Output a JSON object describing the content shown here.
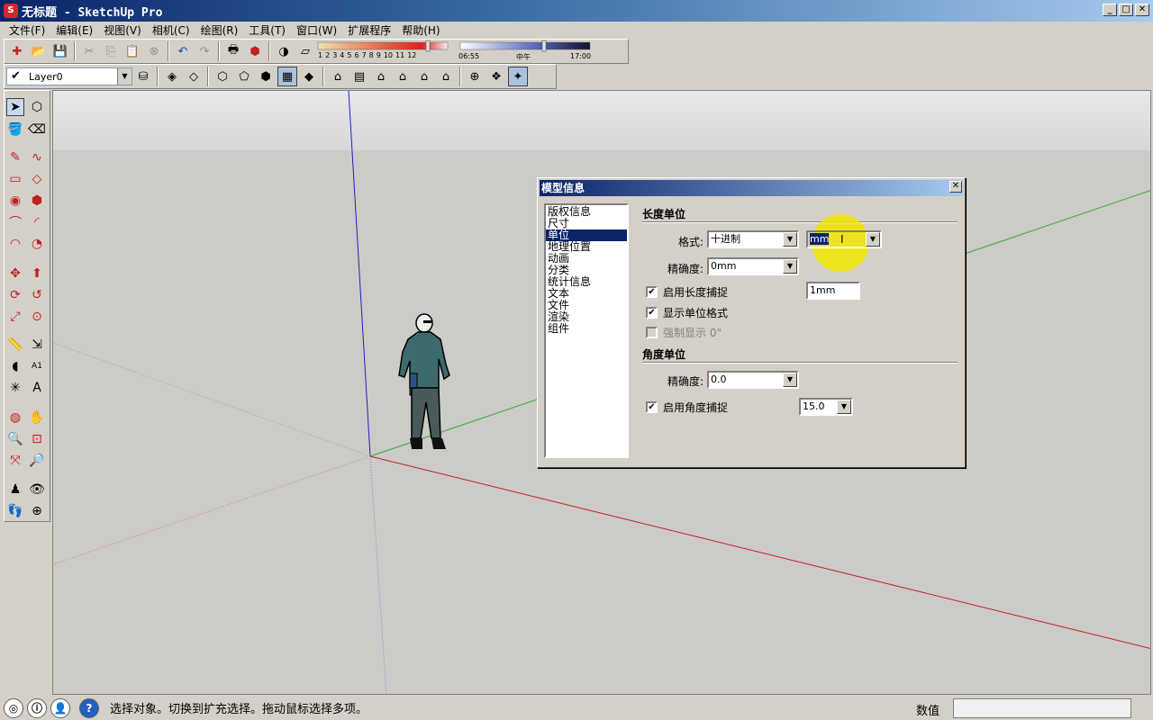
{
  "window": {
    "title": "无标题 - SketchUp Pro",
    "btn_minimize": "_",
    "btn_maximize": "□",
    "btn_close": "✕"
  },
  "menu": {
    "items": [
      "文件(F)",
      "编辑(E)",
      "视图(V)",
      "相机(C)",
      "绘图(R)",
      "工具(T)",
      "窗口(W)",
      "扩展程序",
      "帮助(H)"
    ]
  },
  "toolbar": {
    "shadow_months": [
      "1",
      "2",
      "3",
      "4",
      "5",
      "6",
      "7",
      "8",
      "9",
      "10",
      "11",
      "12"
    ],
    "time_start": "06:55",
    "time_mid": "中午",
    "time_end": "17:00",
    "layer_name": "Layer0"
  },
  "dialog": {
    "title": "模型信息",
    "close": "✕",
    "list_items": [
      "版权信息",
      "尺寸",
      "单位",
      "地理位置",
      "动画",
      "分类",
      "统计信息",
      "文本",
      "文件",
      "渲染",
      "组件"
    ],
    "selected_item": "单位",
    "length_section": "长度单位",
    "format_label": "格式:",
    "format_value": "十进制",
    "unit_value": "mm",
    "precision_label": "精确度:",
    "precision_value": "0mm",
    "enable_length_snap": "启用长度捕捉",
    "length_snap_value": "1mm",
    "show_unit_format": "显示单位格式",
    "force_display": "强制显示 0\"",
    "angle_section": "角度单位",
    "angle_precision_label": "精确度:",
    "angle_precision_value": "0.0",
    "enable_angle_snap": "启用角度捕捉",
    "angle_snap_value": "15.0"
  },
  "status": {
    "message": "选择对象。切换到扩充选择。拖动鼠标选择多项。",
    "measure_label": "数值",
    "measure_value": ""
  }
}
